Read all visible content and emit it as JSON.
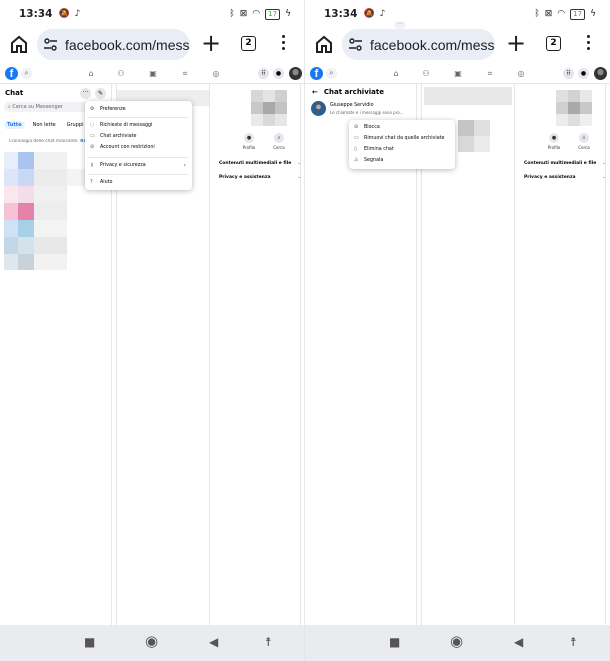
{
  "status": {
    "time": "13:34",
    "battery": "17"
  },
  "browser": {
    "url": "facebook.com/messa",
    "tab_count": "2"
  },
  "left": {
    "chat_title": "Chat",
    "search_placeholder": "Cerca su Messenger",
    "filters": [
      "Tutte",
      "Non lette",
      "Gruppi"
    ],
    "sync_text": "Cronologia delle chat mancante.",
    "sync_link": "Ripristina",
    "menu": {
      "preferences": "Preferenze",
      "requests": "Richieste di messaggi",
      "archived": "Chat archiviate",
      "restricted": "Account con restrizioni",
      "privacy": "Privacy e sicurezza",
      "help": "Aiuto"
    }
  },
  "right": {
    "back_title": "Chat archiviate",
    "contact_name": "Giuseppe Servidio",
    "contact_sub": "Le chiamate e i messaggi sono pro...",
    "menu": {
      "block": "Blocca",
      "unarchive": "Rimuovi chat da quelle archiviate",
      "delete": "Elimina chat",
      "report": "Segnala"
    }
  },
  "profile": {
    "btn_profile": "Profilo",
    "btn_search": "Cerca",
    "media": "Contenuti multimediali e file",
    "privacy": "Privacy e assistenza"
  },
  "colors": {
    "facebook_blue": "#1877f2",
    "menu_bg": "#ffffff",
    "nav_bar": "#e9ebee"
  }
}
